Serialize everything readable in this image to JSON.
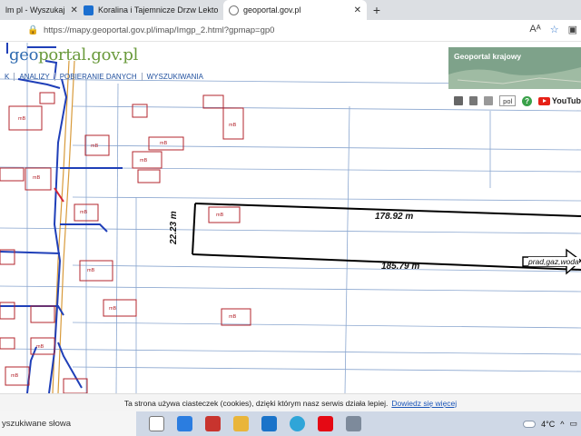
{
  "browser": {
    "tabs": [
      {
        "label": "lm pl - Wyszukaj",
        "active": false
      },
      {
        "label": "Koralina i Tajemnicze Drzw Lekto",
        "active": false
      },
      {
        "label": "geoportal.gov.pl",
        "active": true
      }
    ],
    "new_tab_label": "+",
    "url": "https://mapy.geoportal.gov.pl/imap/Imgp_2.html?gpmap=gp0"
  },
  "geoportal": {
    "logo_prefix": "geo",
    "logo_main": "portal.gov.pl",
    "menu": [
      "K",
      "ANALIZY",
      "POBIERANIE DANYCH",
      "WYSZUKIWANIA"
    ],
    "minimap_title": "Geoportal krajowy",
    "language": "pol",
    "youtube_label": "YouTub"
  },
  "map": {
    "dim_top": "178.92 m",
    "dim_side": "22.23 m",
    "dim_bottom": "185.79 m",
    "arrow_label": "prad,gaz,woda",
    "parcel_colors": {
      "building": "#b3242c",
      "boundary": "#7f9fc9",
      "utility": "#1d3fb5",
      "road": "#d8902a"
    }
  },
  "cookie_bar": {
    "text": "Ta strona używa ciasteczek (cookies), dzięki którym nasz serwis działa lepiej.",
    "link": "Dowiedz się więcej"
  },
  "taskbar": {
    "search_placeholder": "yszukiwane słowa",
    "temperature": "4°C"
  }
}
